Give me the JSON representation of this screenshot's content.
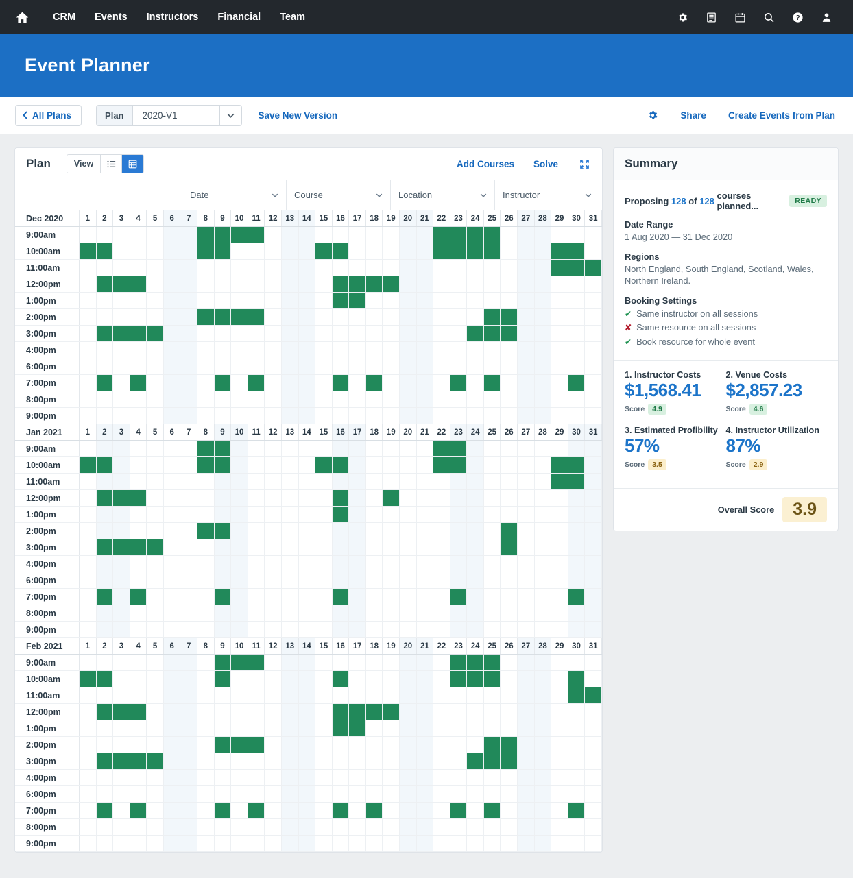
{
  "topnav": {
    "home_icon": "home-icon",
    "links": [
      "CRM",
      "Events",
      "Instructors",
      "Financial",
      "Team"
    ],
    "icons": [
      "gear-icon",
      "list-report-icon",
      "calendar-icon",
      "search-icon",
      "help-icon",
      "user-icon"
    ]
  },
  "banner": {
    "title": "Event Planner"
  },
  "plan_toolbar": {
    "all_plans": "All Plans",
    "plan_label": "Plan",
    "plan_value": "2020-V1",
    "save_new_version": "Save New Version",
    "gear_icon": "gear-icon",
    "share": "Share",
    "create_events": "Create Events from Plan"
  },
  "plan_card": {
    "title": "Plan",
    "view_label": "View",
    "view_list_icon": "list-view-icon",
    "view_grid_icon": "grid-view-icon",
    "add_courses": "Add Courses",
    "solve": "Solve",
    "expand_icon": "fullscreen-expand-icon",
    "filters": [
      "Date",
      "Course",
      "Location",
      "Instructor"
    ],
    "times": [
      "9:00am",
      "10:00am",
      "11:00am",
      "12:00pm",
      "1:00pm",
      "2:00pm",
      "3:00pm",
      "4:00pm",
      "6:00pm",
      "7:00pm",
      "8:00pm",
      "9:00pm"
    ],
    "months": [
      {
        "label": "Dec 2020",
        "days": 31,
        "weekend_days": [
          6,
          7,
          13,
          14,
          20,
          21,
          27,
          28
        ],
        "booked": {
          "9:00am": [
            8,
            9,
            10,
            11,
            22,
            23,
            24,
            25
          ],
          "10:00am": [
            1,
            2,
            8,
            9,
            15,
            16,
            22,
            23,
            24,
            25,
            29,
            30
          ],
          "11:00am": [
            29,
            30,
            31
          ],
          "12:00pm": [
            2,
            3,
            4,
            16,
            17,
            18,
            19
          ],
          "1:00pm": [
            16,
            17
          ],
          "2:00pm": [
            8,
            9,
            10,
            11,
            25,
            26
          ],
          "3:00pm": [
            2,
            3,
            4,
            5,
            24,
            25,
            26
          ],
          "4:00pm": [],
          "6:00pm": [],
          "7:00pm": [
            2,
            4,
            9,
            11,
            16,
            18,
            23,
            25,
            30
          ],
          "8:00pm": [],
          "9:00pm": []
        }
      },
      {
        "label": "Jan 2021",
        "days": 31,
        "weekend_days": [
          2,
          3,
          9,
          10,
          16,
          17,
          23,
          24,
          30,
          31
        ],
        "booked": {
          "9:00am": [
            8,
            9,
            22,
            23
          ],
          "10:00am": [
            1,
            2,
            8,
            9,
            15,
            16,
            22,
            23,
            29,
            30
          ],
          "11:00am": [
            29,
            30
          ],
          "12:00pm": [
            2,
            3,
            4,
            16,
            19
          ],
          "1:00pm": [
            16
          ],
          "2:00pm": [
            8,
            9,
            26
          ],
          "3:00pm": [
            2,
            3,
            4,
            5,
            26
          ],
          "4:00pm": [],
          "6:00pm": [],
          "7:00pm": [
            2,
            4,
            9,
            16,
            23,
            30
          ],
          "8:00pm": [],
          "9:00pm": []
        }
      },
      {
        "label": "Feb 2021",
        "days": 31,
        "weekend_days": [
          6,
          7,
          13,
          14,
          20,
          21,
          27,
          28
        ],
        "booked": {
          "9:00am": [
            9,
            10,
            11,
            23,
            24,
            25
          ],
          "10:00am": [
            1,
            2,
            9,
            16,
            23,
            24,
            25,
            30
          ],
          "11:00am": [
            30,
            31
          ],
          "12:00pm": [
            2,
            3,
            4,
            16,
            17,
            18,
            19
          ],
          "1:00pm": [
            16,
            17
          ],
          "2:00pm": [
            9,
            10,
            11,
            25,
            26
          ],
          "3:00pm": [
            2,
            3,
            4,
            5,
            24,
            25,
            26
          ],
          "4:00pm": [],
          "6:00pm": [],
          "7:00pm": [
            2,
            4,
            9,
            11,
            16,
            18,
            23,
            25,
            30
          ],
          "8:00pm": [],
          "9:00pm": []
        }
      }
    ]
  },
  "summary": {
    "title": "Summary",
    "proposing_prefix": "Proposing",
    "proposing_count": "128",
    "proposing_of": "of",
    "proposing_total": "128",
    "proposing_suffix": "courses planned...",
    "status_badge": "READY",
    "date_range_label": "Date Range",
    "date_range_value": "1 Aug 2020 — 31 Dec 2020",
    "regions_label": "Regions",
    "regions_value": "North England, South England, Scotland, Wales, Northern Ireland.",
    "booking_label": "Booking Settings",
    "booking_items": [
      {
        "icon": "check-circle-icon",
        "ok": true,
        "text": "Same instructor on all sessions"
      },
      {
        "icon": "cross-icon",
        "ok": false,
        "text": "Same resource on all sessions"
      },
      {
        "icon": "check-circle-icon",
        "ok": true,
        "text": "Book resource for whole event"
      }
    ],
    "metrics": [
      {
        "label": "1. Instructor Costs",
        "value": "$1,568.41",
        "score_label": "Score",
        "score": "4.9",
        "tone": "green"
      },
      {
        "label": "2. Venue Costs",
        "value": "$2,857.23",
        "score_label": "Score",
        "score": "4.6",
        "tone": "green"
      },
      {
        "label": "3. Estimated Profibility",
        "value": "57%",
        "score_label": "Score",
        "score": "3.5",
        "tone": "amber"
      },
      {
        "label": "4. Instructor Utilization",
        "value": "87%",
        "score_label": "Score",
        "score": "2.9",
        "tone": "amber"
      }
    ],
    "overall_label": "Overall Score",
    "overall_value": "3.9"
  },
  "colors": {
    "nav_bg": "#23282d",
    "banner_blue": "#1c6fc4",
    "link_blue": "#1668bd",
    "booked_green": "#21895a",
    "weekend_tint": "#f2f7fb",
    "badge_green_bg": "#d8f0e0",
    "score_amber_bg": "#fbeecb",
    "overall_bg": "#fbf0d2"
  }
}
